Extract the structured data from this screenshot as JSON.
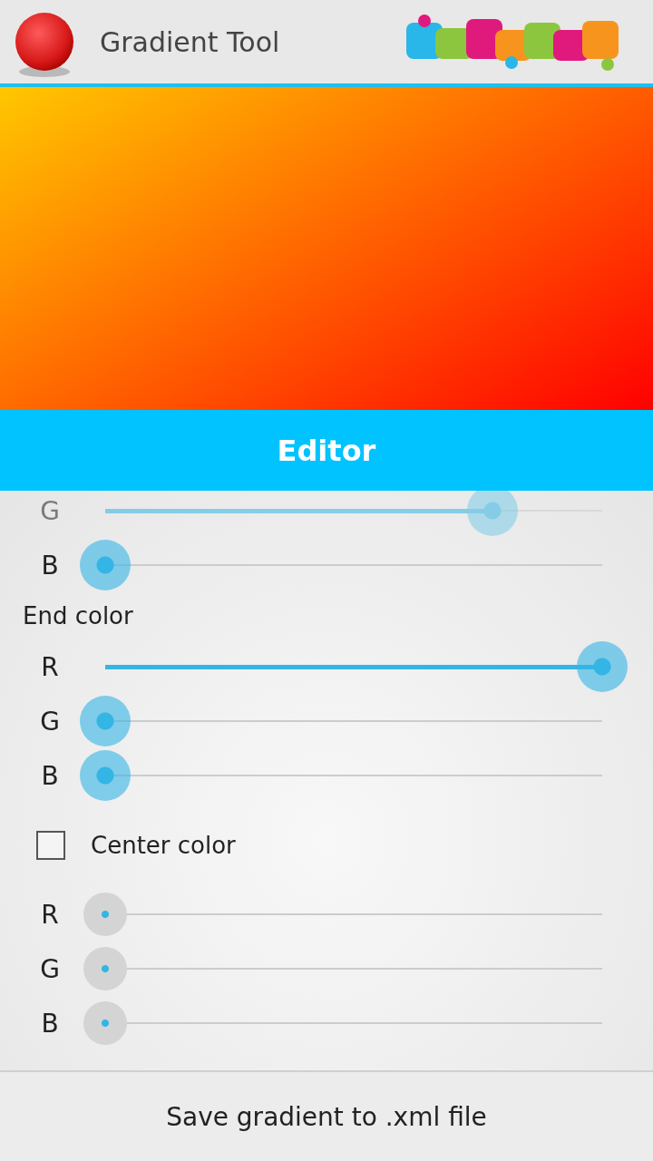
{
  "app_bar": {
    "title": "Gradient Tool"
  },
  "section_title": "Editor",
  "start_color": {
    "sliders": [
      {
        "label": "G",
        "level": 0.78,
        "disabled": false
      },
      {
        "label": "B",
        "level": 0,
        "disabled": false
      }
    ]
  },
  "end_color": {
    "heading": "End color",
    "sliders": [
      {
        "label": "R",
        "level": 1,
        "disabled": false
      },
      {
        "label": "G",
        "level": 0,
        "disabled": false
      },
      {
        "label": "B",
        "level": 0,
        "disabled": false
      }
    ]
  },
  "center_color": {
    "label": "Center color",
    "checked": false,
    "sliders": [
      {
        "label": "R",
        "level": 0,
        "disabled": true
      },
      {
        "label": "G",
        "level": 0,
        "disabled": true
      },
      {
        "label": "B",
        "level": 0,
        "disabled": true
      }
    ]
  },
  "save_button": "Save gradient to .xml file"
}
